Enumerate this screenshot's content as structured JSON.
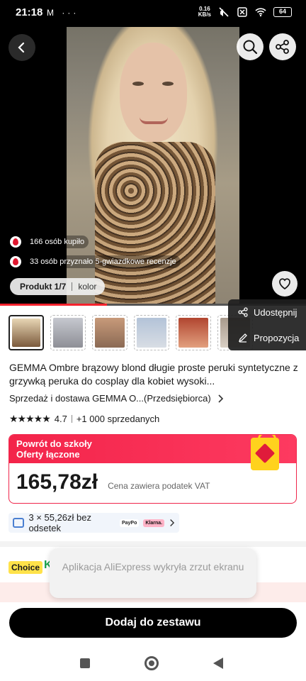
{
  "status_bar": {
    "time": "21:18",
    "left_icons": "M ···",
    "speed_value": "0.16",
    "speed_unit": "KB/s",
    "battery": "64"
  },
  "gallery": {
    "bought_text": "166 osób kupiło",
    "reviews_text": "33 osób przyznało 5-gwiazdkowe recenzje",
    "product_counter": "Produkt 1/7",
    "color_label": "kolor",
    "progress": 0.35
  },
  "share_menu": {
    "share_label": "Udostępnij",
    "propose_label": "Propozycja"
  },
  "thumbnails": [
    {
      "color_a": "#e8d6b4",
      "color_b": "#7b5a3c"
    },
    {
      "color_a": "#c6c8cf",
      "color_b": "#8e8f96"
    },
    {
      "color_a": "#c89a7a",
      "color_b": "#8b6a54"
    },
    {
      "color_a": "#b3c3d8",
      "color_b": "#d8dde4"
    },
    {
      "color_a": "#b1452f",
      "color_b": "#e2a07f"
    },
    {
      "color_a": "#a89a8c",
      "color_b": "#d9cfc4"
    }
  ],
  "product": {
    "title": "GEMMA Ombre brązowy blond długie proste peruki syntetyczne z grzywką peruka do cosplay dla kobiet wysoki...",
    "seller": "Sprzedaż i dostawa GEMMA O...(Przedsiębiorca)",
    "stars": "★★★★★",
    "rating": "4.7",
    "sold": "+1 000 sprzedanych"
  },
  "promo": {
    "line1": "Powrót do szkoły",
    "line2": "Oferty łączone",
    "price": "165,78zł",
    "vat_note": "Cena zawiera podatek VAT"
  },
  "installments": {
    "text": "3 × 55,26zł bez odsetek",
    "provider1": "PayPo",
    "provider2": "Klarna."
  },
  "choice": {
    "badge": "Choice",
    "letter": "K"
  },
  "toast": {
    "text": "Aplikacja AliExpress wykryła zrzut ekranu"
  },
  "cta": {
    "label": "Dodaj do zestawu"
  },
  "colors": {
    "accent_red": "#f3244a",
    "progress_red": "#f5222d",
    "cta_black": "#000000"
  }
}
